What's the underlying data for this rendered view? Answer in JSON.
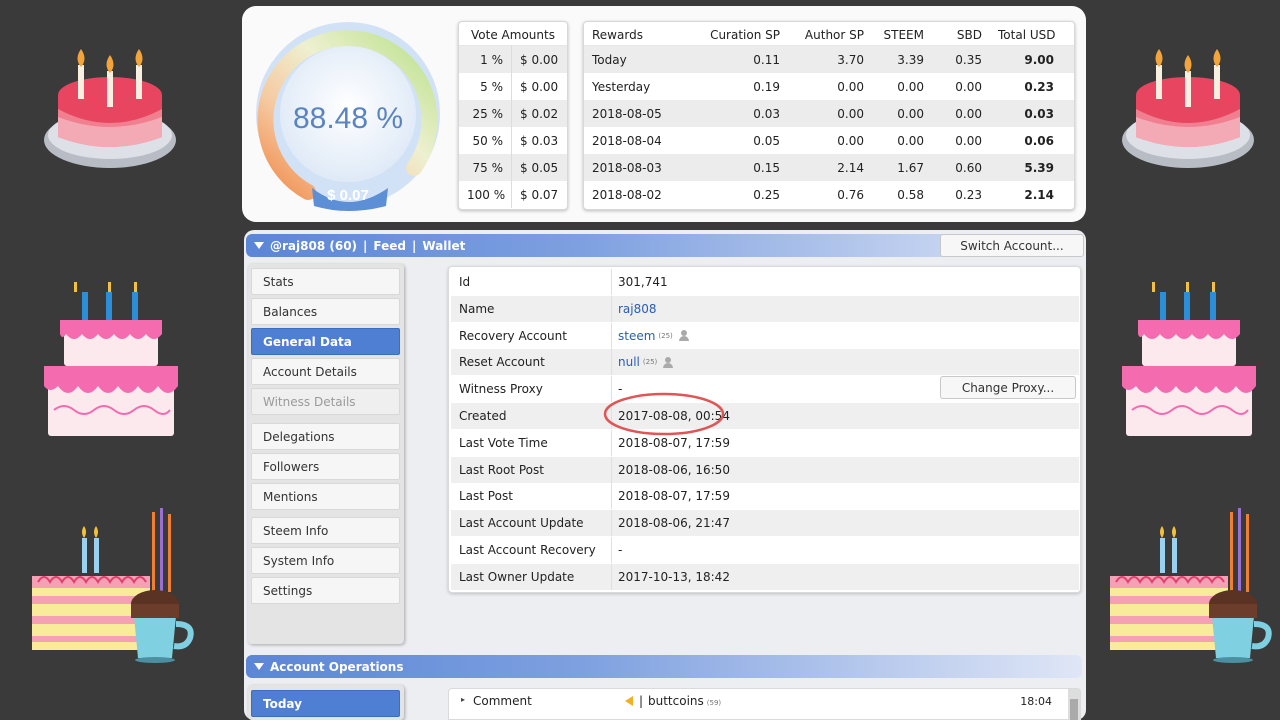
{
  "gauge": {
    "percent": "88.48 %",
    "value": "$ 0.07"
  },
  "vote_amounts": {
    "header": "Vote Amounts",
    "rows": [
      [
        "1 %",
        "$ 0.00"
      ],
      [
        "5 %",
        "$ 0.00"
      ],
      [
        "25 %",
        "$ 0.02"
      ],
      [
        "50 %",
        "$ 0.03"
      ],
      [
        "75 %",
        "$ 0.05"
      ],
      [
        "100 %",
        "$ 0.07"
      ]
    ]
  },
  "rewards": {
    "headers": [
      "Rewards",
      "Curation SP",
      "Author SP",
      "STEEM",
      "SBD",
      "Total USD"
    ],
    "rows": [
      [
        "Today",
        "0.11",
        "3.70",
        "3.39",
        "0.35",
        "9.00"
      ],
      [
        "Yesterday",
        "0.19",
        "0.00",
        "0.00",
        "0.00",
        "0.23"
      ],
      [
        "2018-08-05",
        "0.03",
        "0.00",
        "0.00",
        "0.00",
        "0.03"
      ],
      [
        "2018-08-04",
        "0.05",
        "0.00",
        "0.00",
        "0.00",
        "0.06"
      ],
      [
        "2018-08-03",
        "0.15",
        "2.14",
        "1.67",
        "0.60",
        "5.39"
      ],
      [
        "2018-08-02",
        "0.25",
        "0.76",
        "0.58",
        "0.23",
        "2.14"
      ]
    ]
  },
  "account_bar": {
    "user": "@raj808 (60)",
    "sep": "|",
    "feed": "Feed",
    "wallet": "Wallet",
    "switch_button": "Switch Account..."
  },
  "sidebar": {
    "items": [
      {
        "label": "Stats"
      },
      {
        "label": "Balances"
      },
      {
        "label": "General Data"
      },
      {
        "label": "Account Details"
      },
      {
        "label": "Witness Details"
      },
      {
        "label": "Delegations"
      },
      {
        "label": "Followers"
      },
      {
        "label": "Mentions"
      },
      {
        "label": "Steem Info"
      },
      {
        "label": "System Info"
      },
      {
        "label": "Settings"
      }
    ]
  },
  "general_data": {
    "rows": [
      {
        "key": "Id",
        "value": "301,741"
      },
      {
        "key": "Name",
        "value": "raj808"
      },
      {
        "key": "Recovery Account",
        "value": "steem",
        "rep": "(25)"
      },
      {
        "key": "Reset Account",
        "value": "null",
        "rep": "(25)"
      },
      {
        "key": "Witness Proxy",
        "value": "-"
      },
      {
        "key": "Created",
        "value": "2017-08-08, 00:54"
      },
      {
        "key": "Last Vote Time",
        "value": "2018-08-07, 17:59"
      },
      {
        "key": "Last Root Post",
        "value": "2018-08-06, 16:50"
      },
      {
        "key": "Last Post",
        "value": "2018-08-07, 17:59"
      },
      {
        "key": "Last Account Update",
        "value": "2018-08-06, 21:47"
      },
      {
        "key": "Last Account Recovery",
        "value": "-"
      },
      {
        "key": "Last Owner Update",
        "value": "2017-10-13, 18:42"
      }
    ],
    "change_proxy_button": "Change Proxy..."
  },
  "operations": {
    "title": "Account Operations",
    "tab_today": "Today",
    "op_type": "Comment",
    "op_sep": "|",
    "op_user": "buttcoins",
    "op_rep": "(59)",
    "op_time": "18:04"
  },
  "colors": {
    "accent": "#4f7fd3",
    "annotation": "#e05555"
  }
}
